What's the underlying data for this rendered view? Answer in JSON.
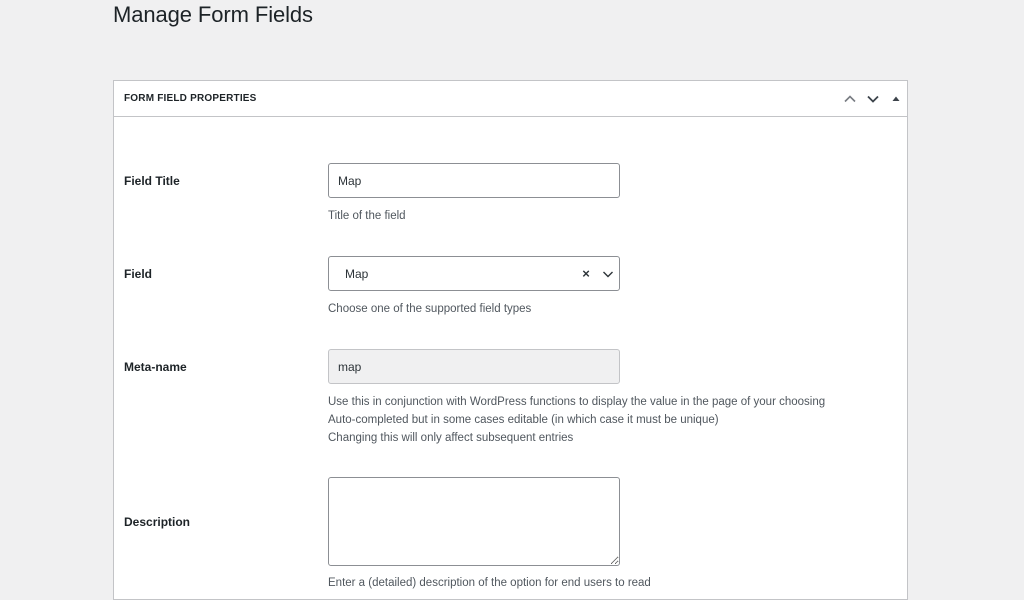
{
  "page": {
    "title": "Manage Form Fields"
  },
  "postbox": {
    "title": "FORM FIELD PROPERTIES",
    "icons": [
      "chevron-up-icon",
      "chevron-down-icon",
      "triangle-up-icon"
    ]
  },
  "fields": {
    "field_title": {
      "label": "Field Title",
      "value": "Map",
      "help": "Title of the field"
    },
    "field_type": {
      "label": "Field",
      "selected": "Map",
      "clear_glyph": "×",
      "help": "Choose one of the supported field types"
    },
    "meta_name": {
      "label": "Meta-name",
      "value": "map",
      "help": [
        "Use this in conjunction with WordPress functions to display the value in the page of your choosing",
        "Auto-completed but in some cases editable (in which case it must be unique)",
        "Changing this will only affect subsequent entries"
      ]
    },
    "description": {
      "label": "Description",
      "value": "",
      "help": "Enter a (detailed) description of the option for end users to read"
    }
  },
  "colors": {
    "background": "#f0f0f1",
    "panel": "#ffffff",
    "border": "#c3c4c7",
    "input_border": "#8c8f94",
    "text": "#1d2327",
    "help_text": "#50575e",
    "icon": "#787c82"
  }
}
